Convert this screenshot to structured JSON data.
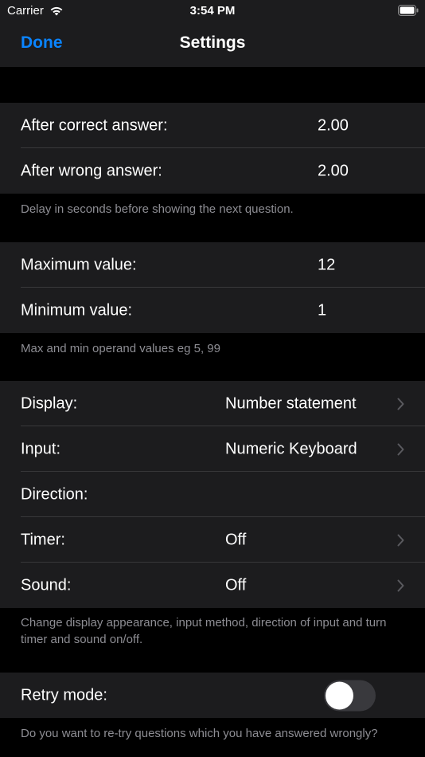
{
  "status_bar": {
    "carrier": "Carrier",
    "time": "3:54 PM",
    "wifi_icon": "wifi-icon",
    "battery_icon": "battery-icon"
  },
  "nav": {
    "done_label": "Done",
    "title": "Settings"
  },
  "delay_section": {
    "rows": [
      {
        "label": "After correct answer:",
        "value": "2.00"
      },
      {
        "label": "After wrong answer:",
        "value": "2.00"
      }
    ],
    "footer": "Delay in seconds before showing the next question."
  },
  "range_section": {
    "rows": [
      {
        "label": "Maximum value:",
        "value": "12"
      },
      {
        "label": "Minimum value:",
        "value": "1"
      }
    ],
    "footer": "Max and min operand values eg 5, 99"
  },
  "display_section": {
    "rows": [
      {
        "label": "Display:",
        "value": "Number statement"
      },
      {
        "label": "Input:",
        "value": "Numeric Keyboard"
      },
      {
        "label": "Direction:",
        "value": ""
      },
      {
        "label": "Timer:",
        "value": "Off"
      },
      {
        "label": "Sound:",
        "value": "Off"
      }
    ],
    "footer": "Change display appearance, input method, direction of input and turn timer and sound on/off."
  },
  "retry_section": {
    "label": "Retry mode:",
    "toggle_on": false,
    "footer": "Do you want to re-try questions which you have answered wrongly?"
  },
  "colors": {
    "accent": "#0a84ff",
    "background": "#000000",
    "cell": "#1c1c1e",
    "secondary_text": "#8d8d93",
    "separator": "#38383a",
    "toggle_off": "#39393d"
  }
}
